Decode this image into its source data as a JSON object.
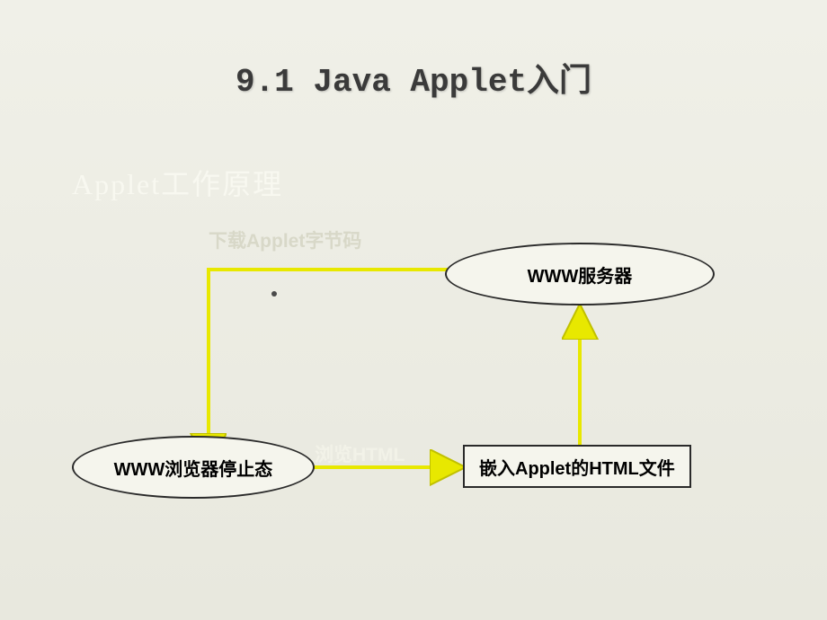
{
  "title": "9.1 Java Applet入门",
  "subtitle": "Applet工作原理",
  "nodes": {
    "server": "WWW服务器",
    "browser": "WWW浏览器停止态",
    "htmlFile": "嵌入Applet的HTML文件"
  },
  "arrows": {
    "download": "下载Applet字节码",
    "browse": "浏览HTML"
  },
  "chart_data": {
    "type": "diagram",
    "title": "Applet工作原理 (Applet Working Principle)",
    "nodes": [
      {
        "id": "server",
        "label": "WWW服务器",
        "shape": "ellipse"
      },
      {
        "id": "browser",
        "label": "WWW浏览器停止态",
        "shape": "ellipse"
      },
      {
        "id": "htmlFile",
        "label": "嵌入Applet的HTML文件",
        "shape": "rectangle"
      }
    ],
    "edges": [
      {
        "from": "server",
        "to": "browser",
        "label": "下载Applet字节码"
      },
      {
        "from": "browser",
        "to": "htmlFile",
        "label": "浏览HTML"
      },
      {
        "from": "htmlFile",
        "to": "server",
        "label": ""
      }
    ]
  }
}
